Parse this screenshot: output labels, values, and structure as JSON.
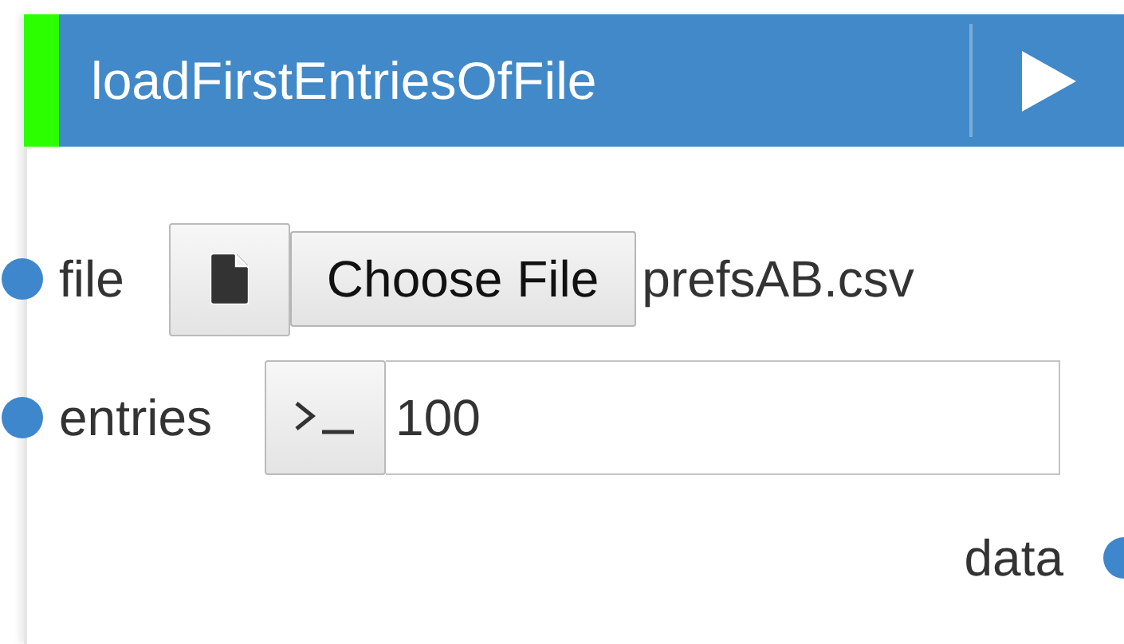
{
  "node": {
    "title": "loadFirstEntriesOfFile",
    "inputs": [
      {
        "kind": "file",
        "label": "file",
        "button": "Choose File",
        "value": "prefsAB.csv"
      },
      {
        "kind": "text",
        "label": "entries",
        "value": "100"
      }
    ],
    "outputs": [
      {
        "label": "data"
      }
    ]
  }
}
